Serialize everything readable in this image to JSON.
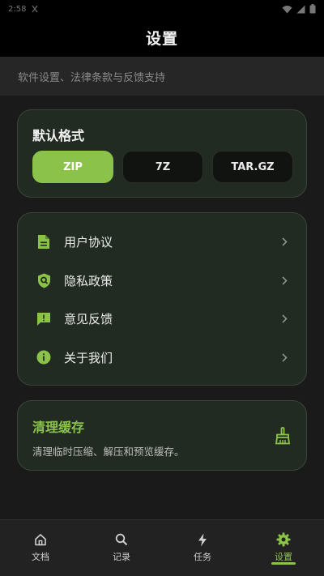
{
  "status_bar": {
    "time": "2:58",
    "time_color": "#777777"
  },
  "header": {
    "title": "设置"
  },
  "subtitle": "软件设置、法律条款与反馈支持",
  "format": {
    "title": "默认格式",
    "options": [
      "ZIP",
      "7Z",
      "TAR.GZ"
    ],
    "selected": "ZIP"
  },
  "links": [
    {
      "label": "用户协议",
      "icon": "document-icon"
    },
    {
      "label": "隐私政策",
      "icon": "shield-search-icon"
    },
    {
      "label": "意见反馈",
      "icon": "feedback-icon"
    },
    {
      "label": "关于我们",
      "icon": "info-icon"
    }
  ],
  "cache": {
    "title": "清理缓存",
    "description": "清理临时压缩、解压和预览缓存。",
    "icon": "broom-icon"
  },
  "nav": {
    "items": [
      {
        "label": "文档",
        "icon": "home-icon"
      },
      {
        "label": "记录",
        "icon": "search-icon"
      },
      {
        "label": "任务",
        "icon": "bolt-icon"
      },
      {
        "label": "设置",
        "icon": "gear-icon"
      }
    ],
    "active": "设置"
  },
  "colors": {
    "accent": "#8bc34a",
    "card_bg": "#222b22",
    "card_border": "#39453a",
    "background": "#1a1a1a"
  }
}
